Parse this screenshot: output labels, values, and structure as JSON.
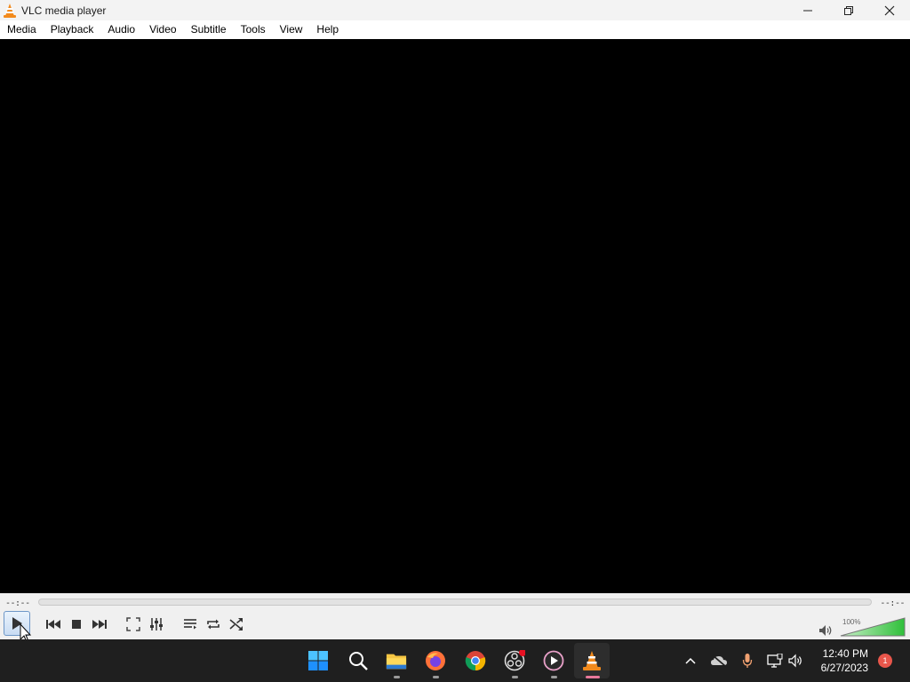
{
  "window": {
    "title": "VLC media player",
    "app_icon": "vlc-cone-icon",
    "controls": [
      "minimize-icon",
      "maximize-icon",
      "close-icon"
    ]
  },
  "menu": {
    "items": [
      "Media",
      "Playback",
      "Audio",
      "Video",
      "Subtitle",
      "Tools",
      "View",
      "Help"
    ]
  },
  "player": {
    "elapsed": "--:--",
    "total": "--:--",
    "volume_percent": "100%",
    "volume_level": 1.0,
    "buttons": [
      "play-icon",
      "previous-icon",
      "stop-icon",
      "next-icon",
      "fullscreen-icon",
      "extended-settings-icon",
      "playlist-icon",
      "loop-icon",
      "shuffle-icon"
    ]
  },
  "taskbar": {
    "apps": [
      "windows-start-icon",
      "search-icon",
      "file-explorer-icon",
      "firefox-icon",
      "chrome-icon",
      "obs-icon",
      "media-player-icon",
      "vlc-icon"
    ],
    "clock_time": "12:40 PM",
    "clock_date": "6/27/2023",
    "notification_count": "1",
    "tray": [
      "chevron-up-icon",
      "onedrive-icon",
      "microphone-icon",
      "network-icon",
      "speaker-icon"
    ]
  },
  "colors": {
    "vlc_orange": "#f28a1c",
    "accent_blue": "#3a78c9",
    "volume_green": "#2fbf3a"
  }
}
